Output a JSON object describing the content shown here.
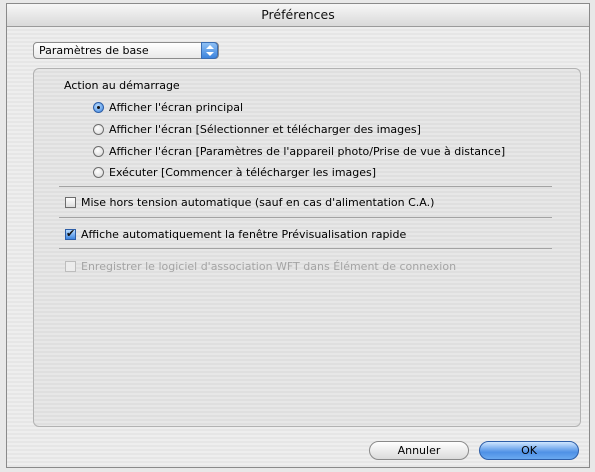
{
  "window": {
    "title": "Préférences"
  },
  "popup": {
    "selected": "Paramètres de base"
  },
  "startup": {
    "label": "Action au démarrage",
    "options": [
      {
        "label": "Afficher l'écran principal",
        "selected": true
      },
      {
        "label": "Afficher l'écran [Sélectionner et télécharger des images]",
        "selected": false
      },
      {
        "label": "Afficher l'écran [Paramètres de l'appareil photo/Prise de vue à distance]",
        "selected": false
      },
      {
        "label": "Exécuter [Commencer à télécharger les images]",
        "selected": false
      }
    ]
  },
  "options": {
    "auto_power_off": {
      "label": "Mise hors tension automatique (sauf en cas d'alimentation C.A.)",
      "checked": false
    },
    "quick_preview": {
      "label": "Affiche automatiquement la fenêtre Prévisualisation rapide",
      "checked": true
    },
    "wft_register": {
      "label": "Enregistrer le logiciel d'association WFT dans Élément de connexion",
      "checked": false,
      "disabled": true
    }
  },
  "buttons": {
    "cancel": "Annuler",
    "ok": "OK"
  }
}
